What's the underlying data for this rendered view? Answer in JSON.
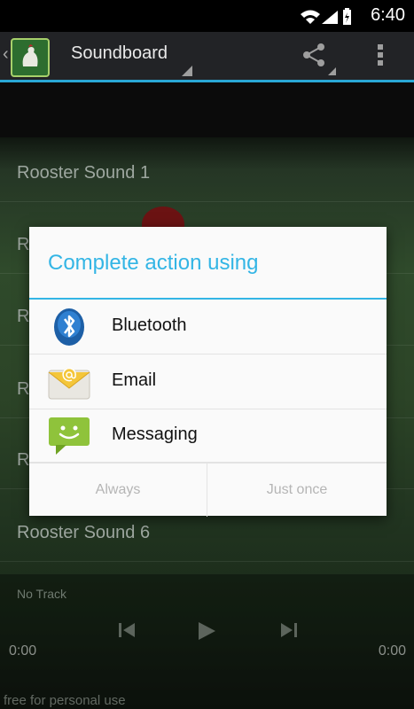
{
  "status": {
    "time": "6:40"
  },
  "actionbar": {
    "title": "Soundboard"
  },
  "list": [
    {
      "label": "Rooster Sound 1"
    },
    {
      "label": "R"
    },
    {
      "label": "R"
    },
    {
      "label": "R"
    },
    {
      "label": "R"
    },
    {
      "label": "Rooster Sound 6"
    }
  ],
  "player": {
    "track": "No Track",
    "time_left": "0:00",
    "time_right": "0:00"
  },
  "footer": {
    "note": "free for personal use"
  },
  "dialog": {
    "title": "Complete action using",
    "options": [
      {
        "label": "Bluetooth",
        "icon": "bluetooth-icon"
      },
      {
        "label": "Email",
        "icon": "email-icon"
      },
      {
        "label": "Messaging",
        "icon": "messaging-icon"
      }
    ],
    "buttons": {
      "always": "Always",
      "just_once": "Just once"
    }
  },
  "colors": {
    "accent": "#33b5e5",
    "actionbar_rule": "#2aa8d6"
  }
}
